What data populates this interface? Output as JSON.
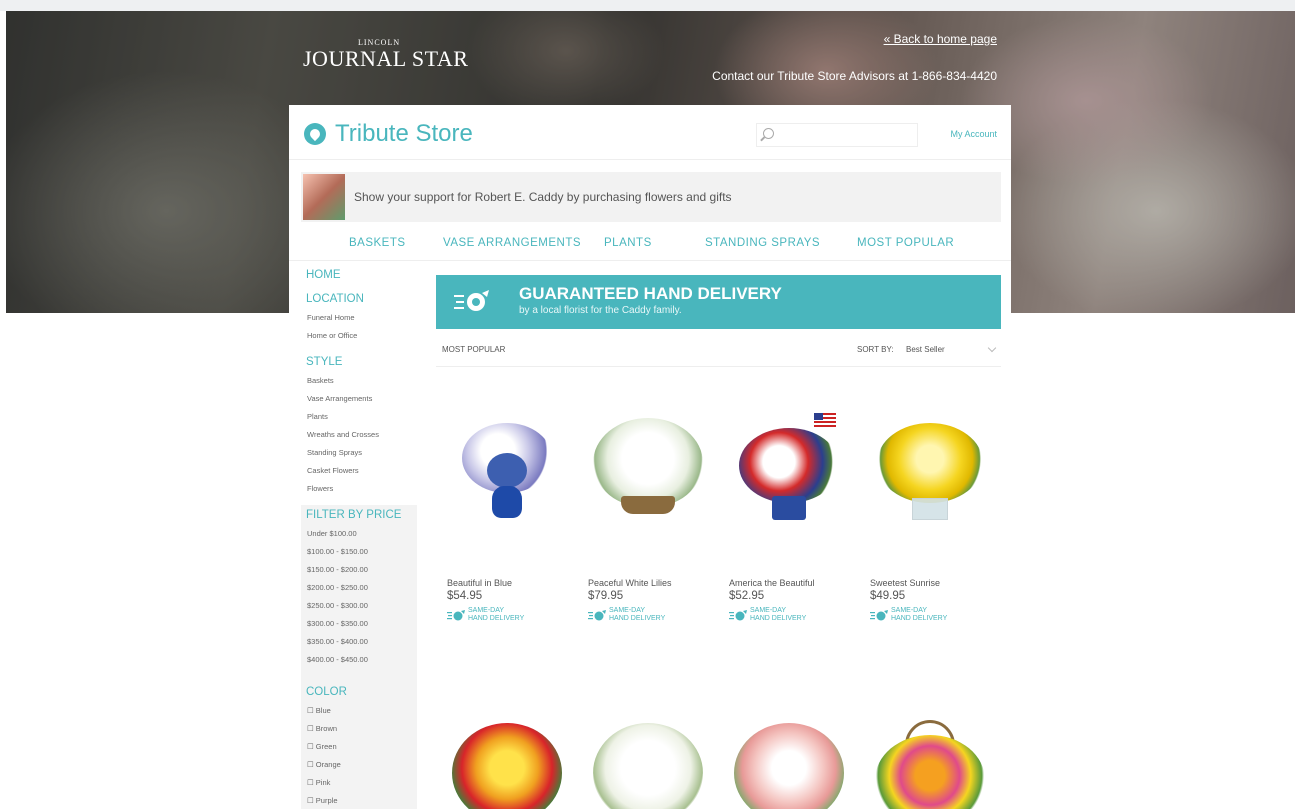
{
  "site": {
    "logo_small": "LINCOLN",
    "logo_main": "JOURNAL STAR",
    "back_link": "« Back to home page",
    "contact": "Contact our Tribute Store Advisors at 1-866-834-4420"
  },
  "store": {
    "title": "Tribute Store",
    "search_placeholder": "",
    "my_account": "My Account",
    "support_text": "Show your support for Robert E. Caddy by purchasing flowers and gifts"
  },
  "topnav": [
    "BASKETS",
    "VASE ARRANGEMENTS",
    "PLANTS",
    "STANDING SPRAYS",
    "MOST POPULAR"
  ],
  "sidebar": {
    "home": "HOME",
    "location_head": "LOCATION",
    "location_items": [
      "Funeral Home",
      "Home or Office"
    ],
    "style_head": "STYLE",
    "style_items": [
      "Baskets",
      "Vase Arrangements",
      "Plants",
      "Wreaths and Crosses",
      "Standing Sprays",
      "Casket Flowers",
      "Flowers"
    ],
    "price_head": "FILTER BY PRICE",
    "price_items": [
      "Under $100.00",
      "$100.00 - $150.00",
      "$150.00 - $200.00",
      "$200.00 - $250.00",
      "$250.00 - $300.00",
      "$300.00 - $350.00",
      "$350.00 - $400.00",
      "$400.00 - $450.00"
    ],
    "color_head": "COLOR",
    "color_items": [
      "☐ Blue",
      "☐ Brown",
      "☐ Green",
      "☐ Orange",
      "☐ Pink",
      "☐ Purple"
    ]
  },
  "delivery": {
    "title": "GUARANTEED HAND DELIVERY",
    "subtitle": "by a local florist for the Caddy family."
  },
  "sort": {
    "category": "MOST POPULAR",
    "label": "SORT BY:",
    "value": "Best Seller"
  },
  "products": [
    {
      "name": "Beautiful in Blue",
      "price": "$54.95",
      "badge_line1": "SAME-DAY",
      "badge_line2": "HAND DELIVERY"
    },
    {
      "name": "Peaceful White Lilies",
      "price": "$79.95",
      "badge_line1": "SAME-DAY",
      "badge_line2": "HAND DELIVERY"
    },
    {
      "name": "America the Beautiful",
      "price": "$52.95",
      "badge_line1": "SAME-DAY",
      "badge_line2": "HAND DELIVERY"
    },
    {
      "name": "Sweetest Sunrise",
      "price": "$49.95",
      "badge_line1": "SAME-DAY",
      "badge_line2": "HAND DELIVERY"
    }
  ],
  "colors": {
    "accent": "#49b6bd",
    "text": "#555555",
    "panel": "#f3f3f3"
  }
}
